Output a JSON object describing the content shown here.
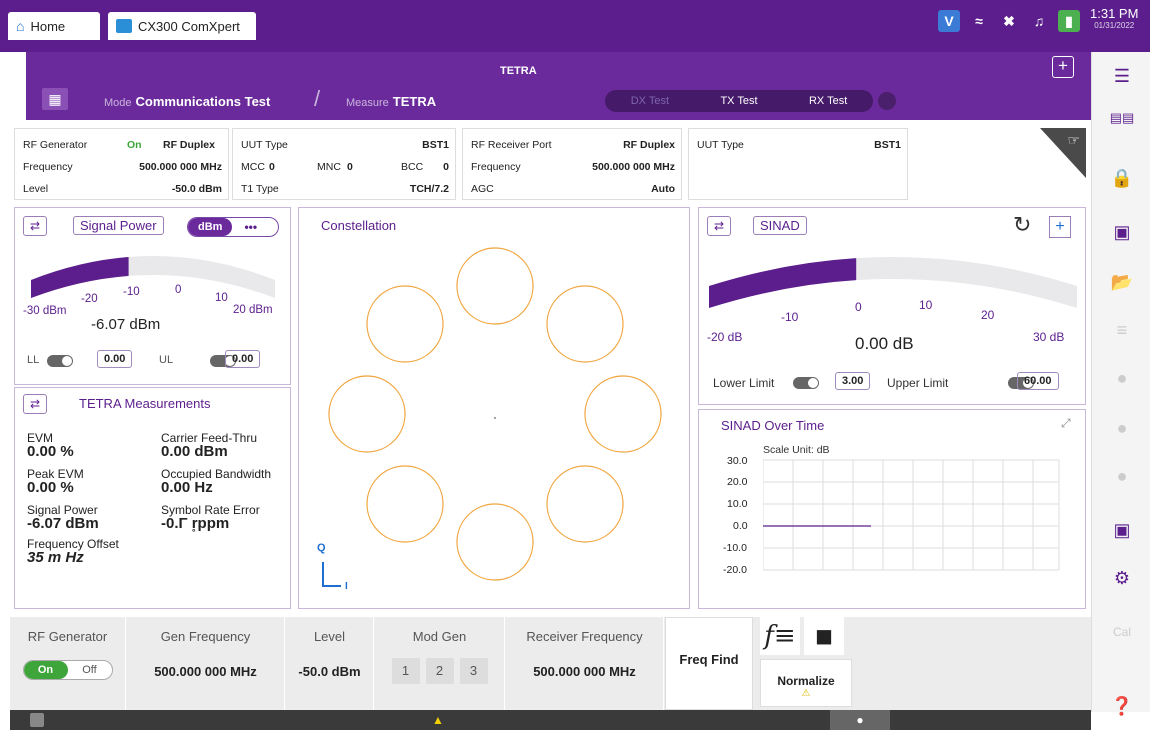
{
  "top_tabs": {
    "home": "Home",
    "app": "CX300 ComXpert"
  },
  "clock": {
    "time": "1:31 PM",
    "date": "01/31/2022"
  },
  "header": {
    "title": "TETRA",
    "mode_label": "Mode",
    "mode_value": "Communications Test",
    "measure_label": "Measure",
    "measure_value": "TETRA",
    "tests": [
      "DX Test",
      "TX Test",
      "RX Test"
    ]
  },
  "info_left": {
    "rf_generator_label": "RF Generator",
    "rf_generator_state": "On",
    "rf_generator_mode": "RF Duplex",
    "frequency_label": "Frequency",
    "frequency_value": "500.000 000 MHz",
    "level_label": "Level",
    "level_value": "-50.0 dBm"
  },
  "info_uut": {
    "uut_type_label": "UUT Type",
    "uut_type_value": "BST1",
    "mcc_label": "MCC",
    "mcc_value": "0",
    "mnc_label": "MNC",
    "mnc_value": "0",
    "bcc_label": "BCC",
    "bcc_value": "0",
    "t1_label": "T1 Type",
    "t1_value": "TCH/7.2"
  },
  "info_rx": {
    "port_label": "RF Receiver Port",
    "port_value": "RF Duplex",
    "frequency_label": "Frequency",
    "frequency_value": "500.000 000 MHz",
    "agc_label": "AGC",
    "agc_value": "Auto"
  },
  "info_uut2": {
    "uut_type_label": "UUT Type",
    "uut_type_value": "BST1"
  },
  "signal_power": {
    "title": "Signal Power",
    "unit": "dBm",
    "more": "•••",
    "ticks": [
      "-30 dBm",
      "-20",
      "-10",
      "0",
      "10",
      "20 dBm"
    ],
    "value": "-6.07 dBm",
    "ll_label": "LL",
    "ll_value": "0.00",
    "ul_label": "UL",
    "ul_value": "0.00",
    "level": 0.4
  },
  "tetra_meas": {
    "title": "TETRA Measurements",
    "items": [
      {
        "label": "EVM",
        "value": "0.00 %"
      },
      {
        "label": "Carrier Feed-Thru",
        "value": "0.00 dBm"
      },
      {
        "label": "Peak EVM",
        "value": "0.00 %"
      },
      {
        "label": "Occupied Bandwidth",
        "value": "0.00 Hz"
      },
      {
        "label": "Signal Power",
        "value": "-6.07 dBm"
      },
      {
        "label": "Symbol Rate Error",
        "value": "-0.Γ r̥ppm"
      },
      {
        "label": "Frequency Offset",
        "value": "35 m Hz"
      }
    ]
  },
  "constellation": {
    "title": "Constellation",
    "axis_q": "Q",
    "axis_i": "I"
  },
  "sinad": {
    "title": "SINAD",
    "ticks": [
      "-20 dB",
      "-10",
      "0",
      "10",
      "20",
      "30 dB"
    ],
    "value": "0.00 dB",
    "lower_label": "Lower Limit",
    "lower_value": "3.00",
    "upper_label": "Upper Limit",
    "upper_value": "60.00",
    "level": 0.4
  },
  "sinad_time": {
    "title": "SINAD Over Time",
    "scale_unit": "Scale Unit: dB",
    "y_ticks": [
      "30.0",
      "20.0",
      "10.0",
      "0.0",
      "-10.0",
      "-20.0"
    ]
  },
  "bottom": {
    "rf_generator": {
      "label": "RF Generator",
      "on": "On",
      "off": "Off"
    },
    "gen_frequency": {
      "label": "Gen Frequency",
      "value": "500.000 000 MHz"
    },
    "level": {
      "label": "Level",
      "value": "-50.0 dBm"
    },
    "mod_gen": {
      "label": "Mod Gen",
      "options": [
        "1",
        "2",
        "3"
      ]
    },
    "receiver_frequency": {
      "label": "Receiver Frequency",
      "value": "500.000 000 MHz"
    },
    "freq_find": "Freq Find",
    "normalize": "Normalize"
  }
}
